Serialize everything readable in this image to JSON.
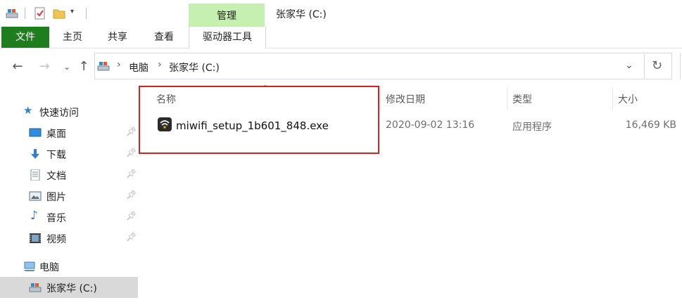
{
  "window": {
    "title": "张家华 (C:)"
  },
  "ribbon": {
    "context_group": "管理",
    "tabs": [
      {
        "label": "文件"
      },
      {
        "label": "主页"
      },
      {
        "label": "共享"
      },
      {
        "label": "查看"
      },
      {
        "label": "驱动器工具"
      }
    ]
  },
  "address": {
    "crumbs": [
      "电脑",
      "张家华 (C:)"
    ]
  },
  "nav": {
    "quick_access": "快速访问",
    "items": [
      {
        "label": "桌面",
        "icon": "desktop-icon"
      },
      {
        "label": "下载",
        "icon": "download-icon"
      },
      {
        "label": "文档",
        "icon": "document-icon"
      },
      {
        "label": "图片",
        "icon": "picture-icon"
      },
      {
        "label": "音乐",
        "icon": "music-icon"
      },
      {
        "label": "视频",
        "icon": "video-icon"
      }
    ],
    "this_pc": "电脑",
    "drive": "张家华 (C:)"
  },
  "columns": {
    "name": "名称",
    "modified": "修改日期",
    "type": "类型",
    "size": "大小"
  },
  "files": [
    {
      "name": "miwifi_setup_1b601_848.exe",
      "modified": "2020-09-02 13:16",
      "type": "应用程序",
      "size": "16,469 KB"
    }
  ],
  "colors": {
    "file_tab": "#1e7e1e",
    "manage_context": "#c6efb2",
    "highlight_box": "#d32222",
    "selected_nav": "#d9d9d9"
  }
}
